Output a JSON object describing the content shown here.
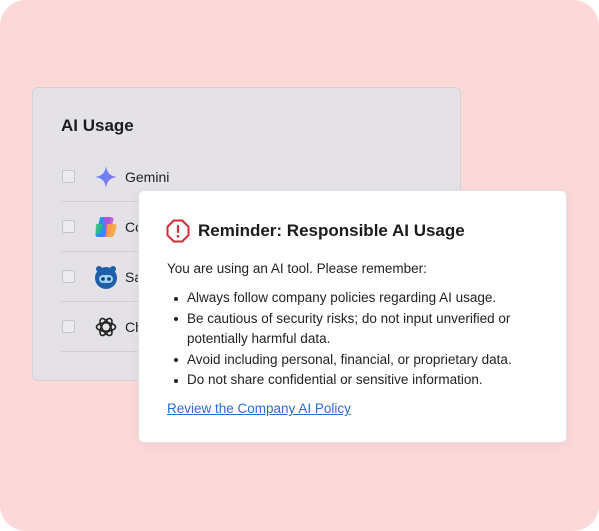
{
  "usage_panel": {
    "title": "AI Usage",
    "tools": [
      {
        "label": "Gemini",
        "icon": "gemini-icon"
      },
      {
        "label": "Co",
        "icon": "copilot-icon"
      },
      {
        "label": "Sa",
        "icon": "sana-icon"
      },
      {
        "label": "Ch",
        "icon": "chatgpt-icon"
      }
    ]
  },
  "reminder": {
    "icon": "alert-octagon-icon",
    "title": "Reminder: Responsible AI Usage",
    "intro": "You are using an AI tool. Please remember:",
    "bullets": [
      "Always follow company policies regarding AI usage.",
      "Be cautious of security risks; do not input unverified or potentially harmful data.",
      "Avoid including personal, financial, or proprietary data.",
      "Do not share confidential or sensitive information."
    ],
    "link": "Review the Company AI Policy"
  },
  "colors": {
    "background": "#fdd8d8",
    "alert": "#d12b35",
    "link": "#2a6dcc"
  }
}
